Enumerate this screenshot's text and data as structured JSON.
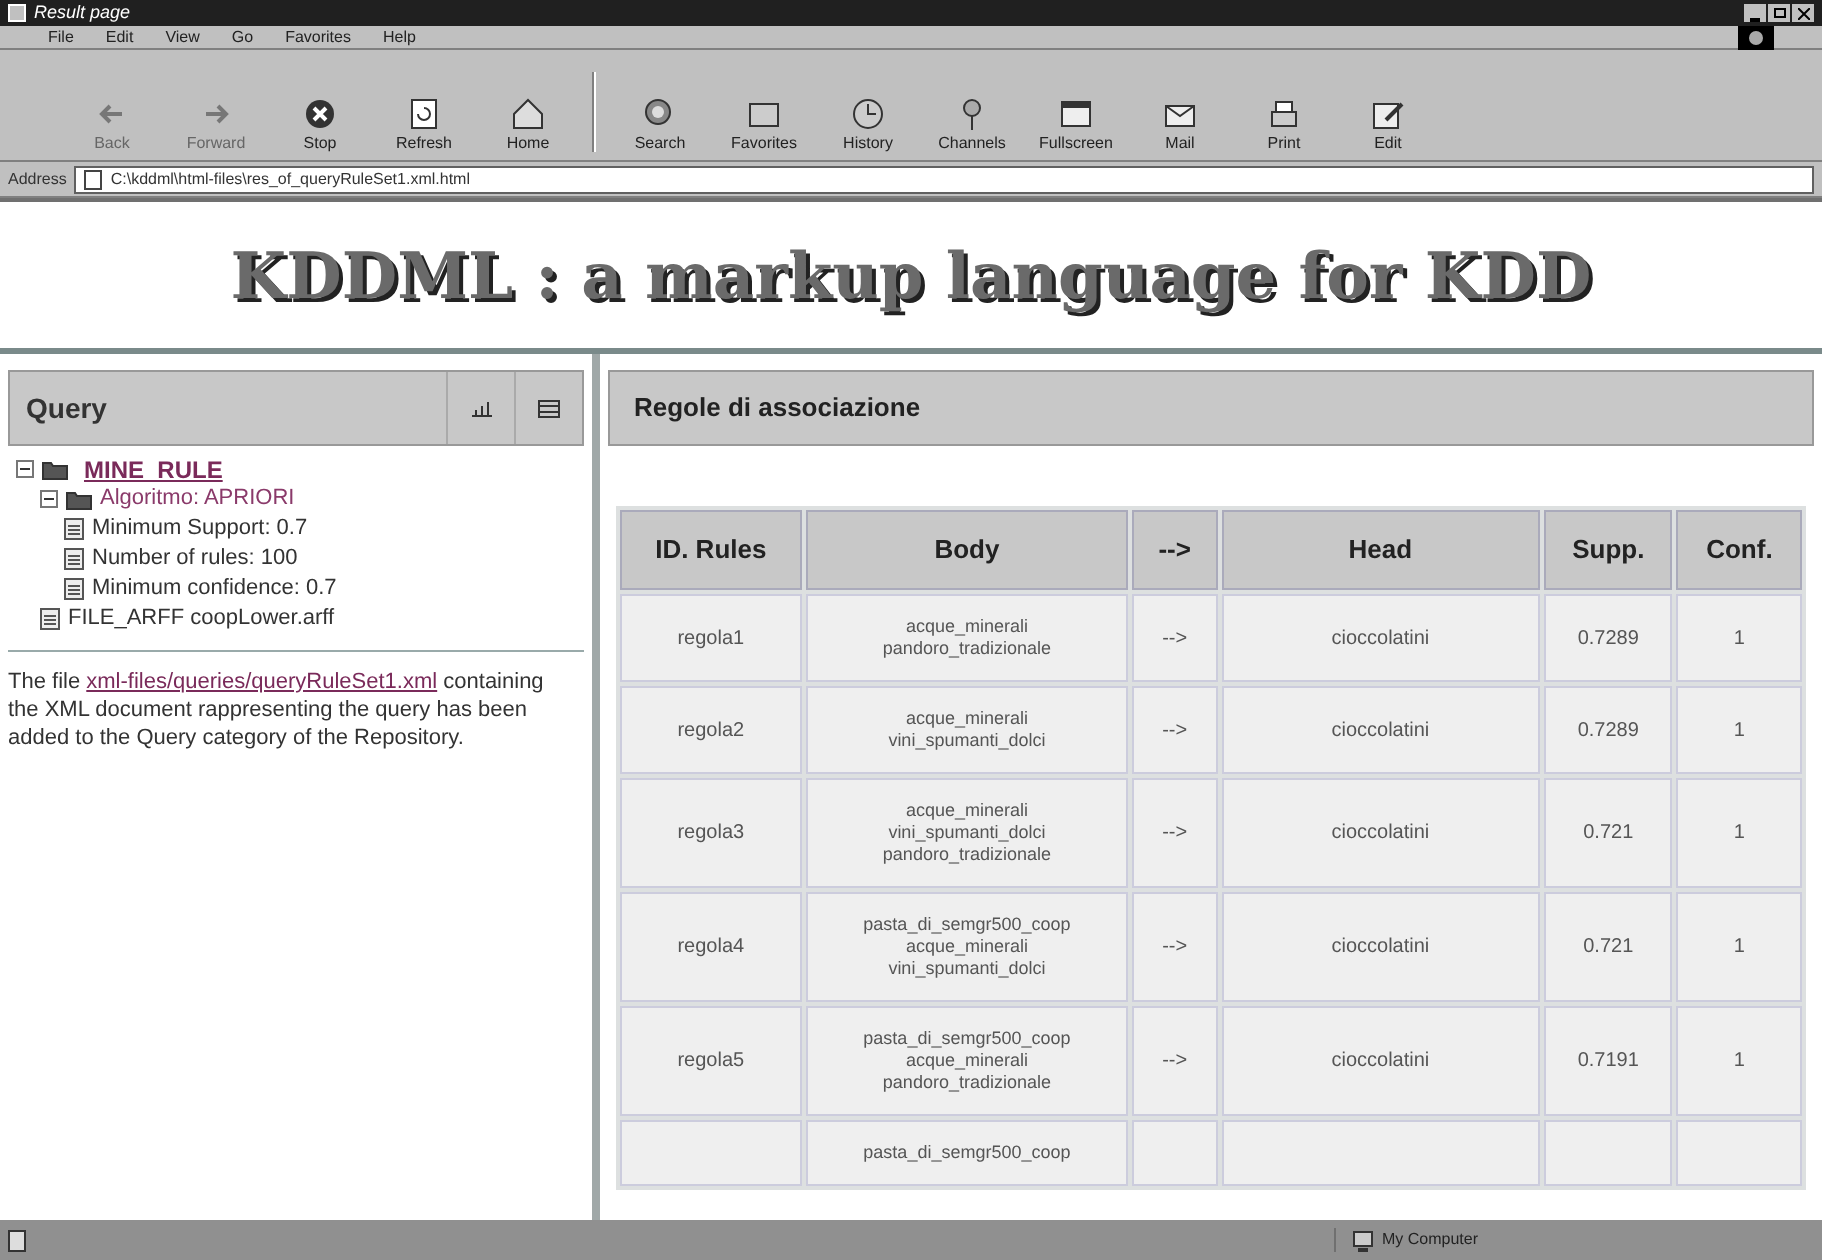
{
  "window": {
    "title": "Result page"
  },
  "menu": [
    "File",
    "Edit",
    "View",
    "Go",
    "Favorites",
    "Help"
  ],
  "toolbar": [
    {
      "label": "Back",
      "disabled": true,
      "kind": "back"
    },
    {
      "label": "Forward",
      "disabled": true,
      "kind": "forward"
    },
    {
      "label": "Stop",
      "disabled": false,
      "kind": "stop"
    },
    {
      "label": "Refresh",
      "disabled": false,
      "kind": "refresh"
    },
    {
      "label": "Home",
      "disabled": false,
      "kind": "home"
    },
    {
      "label": "Search",
      "disabled": false,
      "kind": "search"
    },
    {
      "label": "Favorites",
      "disabled": false,
      "kind": "favorites"
    },
    {
      "label": "History",
      "disabled": false,
      "kind": "history"
    },
    {
      "label": "Channels",
      "disabled": false,
      "kind": "channels"
    },
    {
      "label": "Fullscreen",
      "disabled": false,
      "kind": "fullscreen"
    },
    {
      "label": "Mail",
      "disabled": false,
      "kind": "mail"
    },
    {
      "label": "Print",
      "disabled": false,
      "kind": "print"
    },
    {
      "label": "Edit",
      "disabled": false,
      "kind": "edit"
    }
  ],
  "address": {
    "label": "Address",
    "value": "C:\\kddml\\html-files\\res_of_queryRuleSet1.xml.html"
  },
  "banner": "KDDML : a markup language for KDD",
  "query_panel": {
    "title": "Query",
    "tree": [
      {
        "label": "MINE_RULE",
        "kind": "link",
        "expanded": true,
        "children": [
          {
            "label": "Algoritmo: APRIORI",
            "kind": "folder",
            "expanded": true,
            "children": [
              {
                "label": "Minimum Support: 0.7",
                "kind": "file"
              },
              {
                "label": "Number of rules: 100",
                "kind": "file"
              },
              {
                "label": "Minimum confidence: 0.7",
                "kind": "file"
              }
            ]
          },
          {
            "label": "FILE_ARFF coopLower.arff",
            "kind": "file"
          }
        ]
      }
    ],
    "message": {
      "before": "The file",
      "link": "xml-files/queries/queryRuleSet1.xml",
      "after": "containing the XML document rappresenting the query has been added to the Query category of the Repository."
    }
  },
  "rules_panel": {
    "title": "Regole di associazione",
    "columns": [
      "ID. Rules",
      "Body",
      "-->",
      "Head",
      "Supp.",
      "Conf."
    ],
    "rows": [
      {
        "id": "regola1",
        "body": [
          "acque_minerali",
          "pandoro_tradizionale"
        ],
        "arrow": "-->",
        "head": "cioccolatini",
        "supp": "0.7289",
        "conf": "1"
      },
      {
        "id": "regola2",
        "body": [
          "acque_minerali",
          "vini_spumanti_dolci"
        ],
        "arrow": "-->",
        "head": "cioccolatini",
        "supp": "0.7289",
        "conf": "1"
      },
      {
        "id": "regola3",
        "body": [
          "acque_minerali",
          "vini_spumanti_dolci",
          "pandoro_tradizionale"
        ],
        "arrow": "-->",
        "head": "cioccolatini",
        "supp": "0.721",
        "conf": "1"
      },
      {
        "id": "regola4",
        "body": [
          "pasta_di_semgr500_coop",
          "acque_minerali",
          "vini_spumanti_dolci"
        ],
        "arrow": "-->",
        "head": "cioccolatini",
        "supp": "0.721",
        "conf": "1"
      },
      {
        "id": "regola5",
        "body": [
          "pasta_di_semgr500_coop",
          "acque_minerali",
          "pandoro_tradizionale"
        ],
        "arrow": "-->",
        "head": "cioccolatini",
        "supp": "0.7191",
        "conf": "1"
      },
      {
        "body": [
          "pasta_di_semgr500_coop"
        ]
      }
    ]
  },
  "status_bar": {
    "zone": "My Computer"
  }
}
